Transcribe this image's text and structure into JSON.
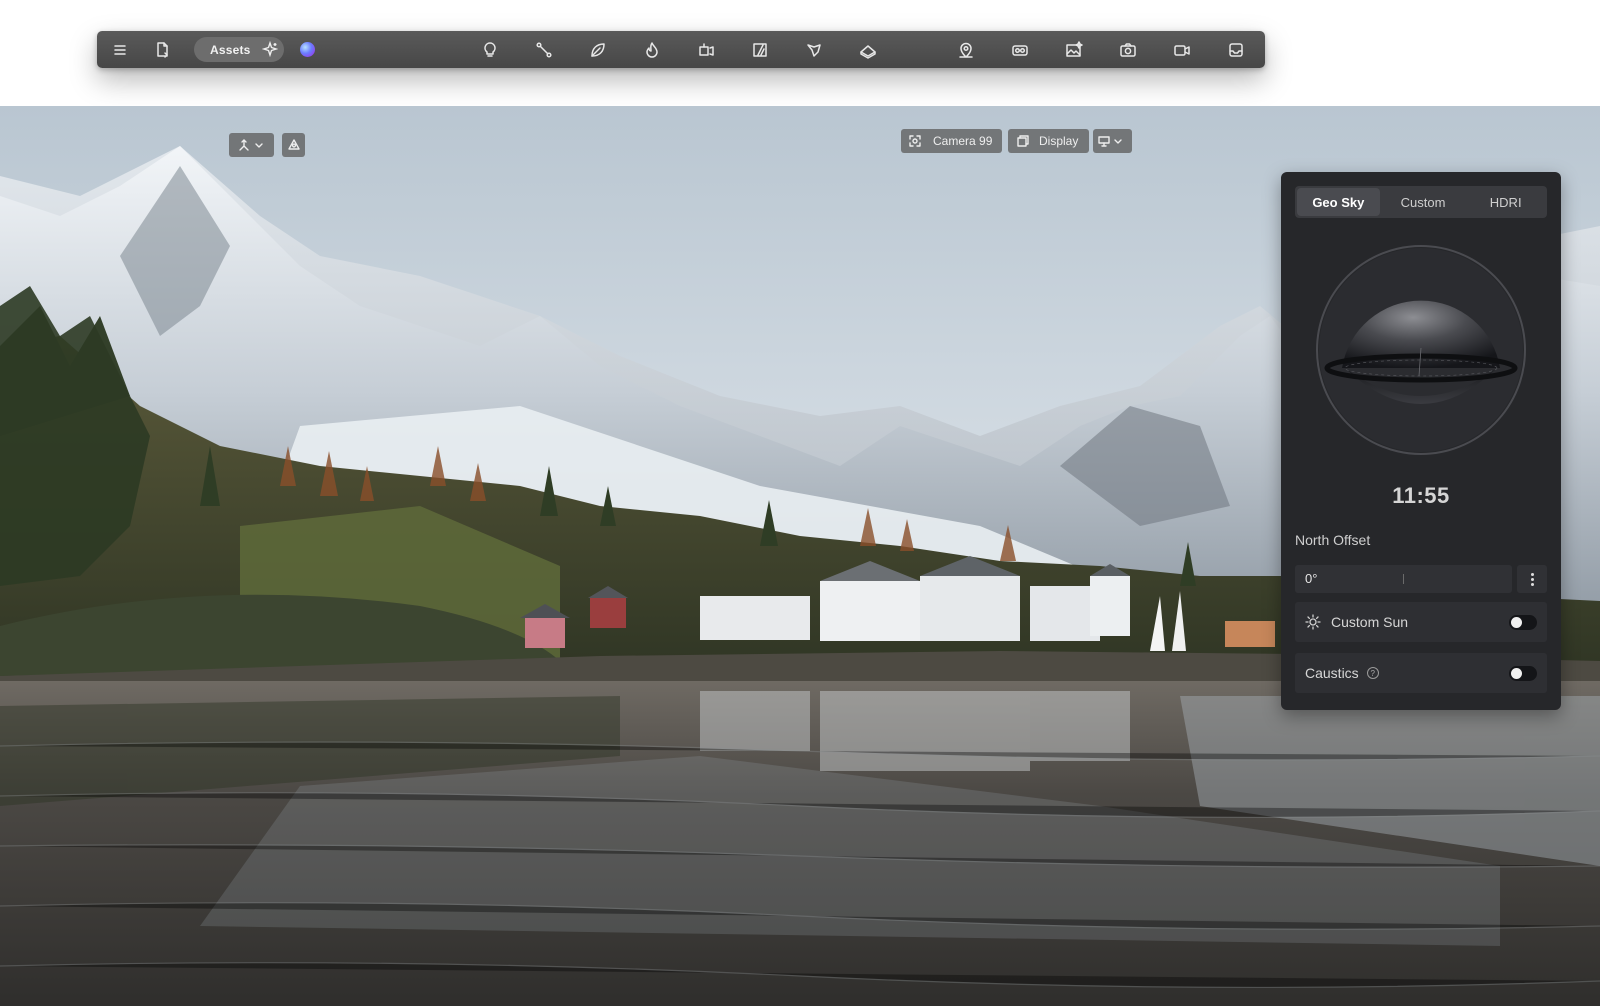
{
  "toolbar": {
    "assets_label": "Assets",
    "icons": [
      "menu-icon",
      "file-export-icon",
      "sparkle-icon",
      "light-bulb-icon",
      "path-icon",
      "leaf-icon",
      "fire-icon",
      "cube-animate-icon",
      "media-panel-icon",
      "terrain-icon",
      "layers-icon",
      "location-pin-icon",
      "vr-headset-icon",
      "image-edit-icon",
      "camera-icon",
      "video-icon",
      "inbox-icon"
    ]
  },
  "viewport": {
    "camera_label": "Camera 99",
    "display_label": "Display"
  },
  "sky_panel": {
    "tabs": [
      {
        "label": "Geo Sky",
        "active": true
      },
      {
        "label": "Custom",
        "active": false
      },
      {
        "label": "HDRI",
        "active": false
      }
    ],
    "time": "11:55",
    "north_offset_label": "North Offset",
    "north_offset_value": "0°",
    "custom_sun_label": "Custom Sun",
    "custom_sun_on": false,
    "caustics_label": "Caustics",
    "caustics_on": false,
    "help_glyph": "?"
  }
}
